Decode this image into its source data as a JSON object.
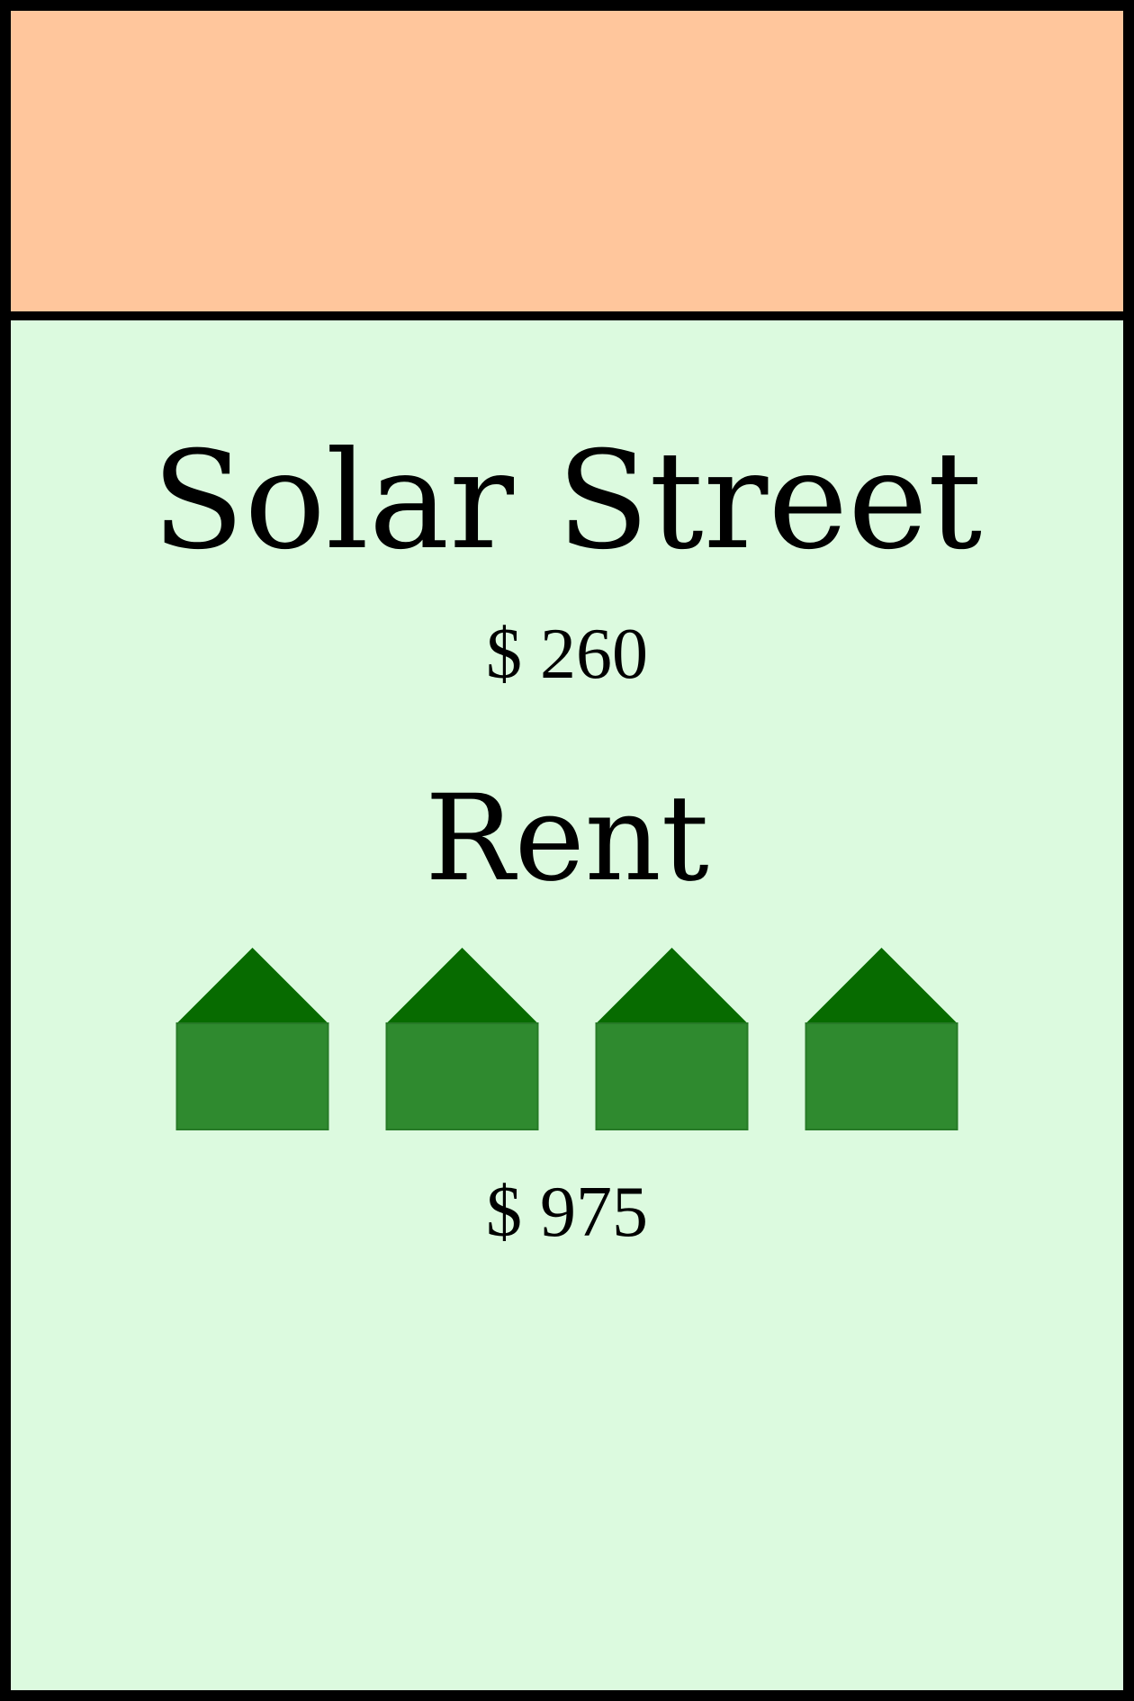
{
  "card": {
    "band_color": "#ffc69c",
    "background_color": "#dcfadf",
    "title": "Solar Street",
    "price": "$ 260",
    "rent_label": "Rent",
    "house_icon": "house-icon",
    "house_count": 4,
    "house_roof_color": "#076b00",
    "house_body_color": "#2f8a2f",
    "rent_value": "$ 975"
  }
}
